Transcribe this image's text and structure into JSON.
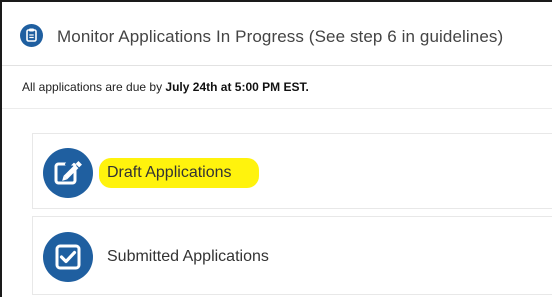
{
  "header": {
    "title": "Monitor Applications In Progress (See step 6 in guidelines)",
    "icon": "clipboard-icon"
  },
  "notice": {
    "prefix": "All applications are due by ",
    "deadline": "July 24th at 5:00 PM EST."
  },
  "items": [
    {
      "label": "Draft Applications",
      "icon": "edit-icon",
      "highlighted": true
    },
    {
      "label": "Submitted Applications",
      "icon": "checkbox-icon",
      "highlighted": false
    }
  ],
  "colors": {
    "accent": "#1f5fa0",
    "highlight": "#fff200"
  }
}
